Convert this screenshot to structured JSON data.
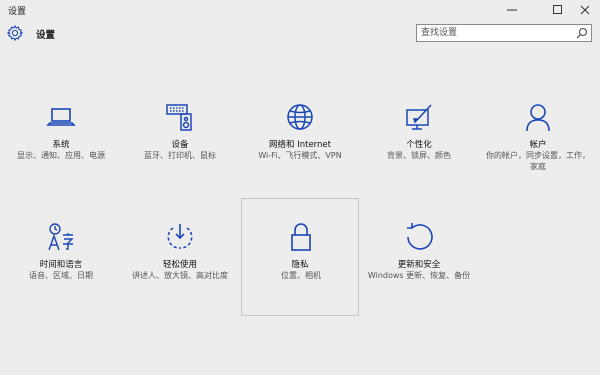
{
  "window": {
    "title": "设置",
    "controls": [
      "minimize-icon",
      "maximize-icon",
      "close-icon"
    ]
  },
  "header": {
    "title": "设置",
    "icon": "gear-icon"
  },
  "search": {
    "placeholder": "查找设置",
    "value": "",
    "icon": "search-icon"
  },
  "accent_color": "#1a47b8",
  "categories": [
    {
      "id": "system",
      "label": "系统",
      "description": "显示、通知、应用、电源",
      "icon": "laptop-icon"
    },
    {
      "id": "devices",
      "label": "设备",
      "description": "蓝牙、打印机、鼠标",
      "icon": "keyboard-speaker-icon"
    },
    {
      "id": "network",
      "label": "网络和 Internet",
      "description": "Wi-Fi、飞行模式、VPN",
      "icon": "globe-icon"
    },
    {
      "id": "personalization",
      "label": "个性化",
      "description": "背景、锁屏、颜色",
      "icon": "paint-screen-icon"
    },
    {
      "id": "accounts",
      "label": "帐户",
      "description": "你的帐户，同步设置，工作，家庭",
      "icon": "person-icon"
    },
    {
      "id": "time-language",
      "label": "时间和语言",
      "description": "语音、区域、日期",
      "icon": "time-language-icon"
    },
    {
      "id": "ease-of-access",
      "label": "轻松使用",
      "description": "讲述人、放大镜、高对比度",
      "icon": "ease-of-access-icon"
    },
    {
      "id": "privacy",
      "label": "隐私",
      "description": "位置、相机",
      "icon": "lock-icon",
      "selected": true
    },
    {
      "id": "update-security",
      "label": "更新和安全",
      "description": "Windows 更新、恢复、备份",
      "icon": "update-arrow-icon"
    }
  ]
}
